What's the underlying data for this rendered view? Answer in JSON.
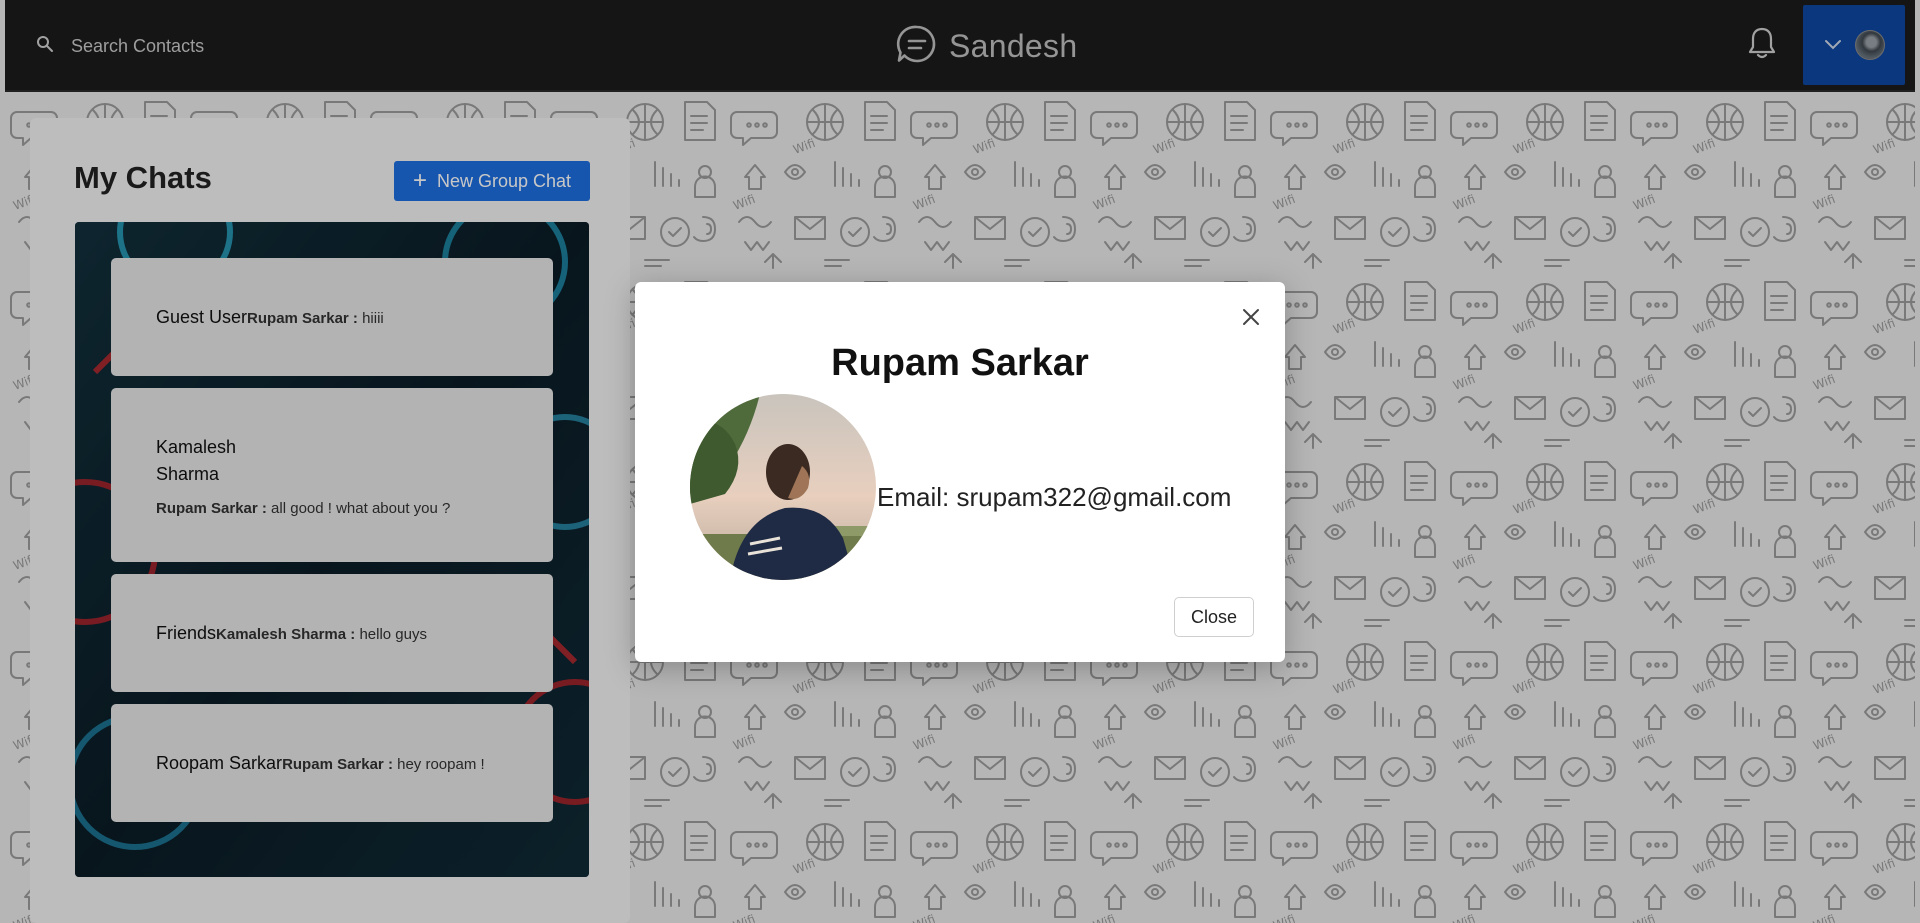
{
  "app": {
    "name": "Sandesh"
  },
  "header": {
    "search_placeholder": "Search Contacts",
    "brand": "Sandesh",
    "icons": [
      "search-icon",
      "chat-logo-icon",
      "bell-icon",
      "chevron-down-icon"
    ]
  },
  "sidebar": {
    "title": "My Chats",
    "new_group_label": "New Group Chat",
    "new_group_icon": "plus-icon",
    "chats": [
      {
        "name": "Guest User",
        "sender": "Rupam Sarkar :",
        "message": "hiiii"
      },
      {
        "name": "Kamalesh Sharma",
        "sender": "Rupam Sarkar :",
        "message": "all good ! what about you ?"
      },
      {
        "name": "Friends",
        "sender": "Kamalesh Sharma :",
        "message": "hello guys"
      },
      {
        "name": "Roopam Sarkar",
        "sender": "Rupam Sarkar :",
        "message": "hey roopam !"
      }
    ]
  },
  "modal": {
    "title": "Rupam Sarkar",
    "email_label": "Email:",
    "email": "srupam322@gmail.com",
    "close_label": "Close"
  },
  "colors": {
    "topbar": "#1c1c1c",
    "accent": "#1e6fe0",
    "profile_button": "#0d47a1"
  }
}
